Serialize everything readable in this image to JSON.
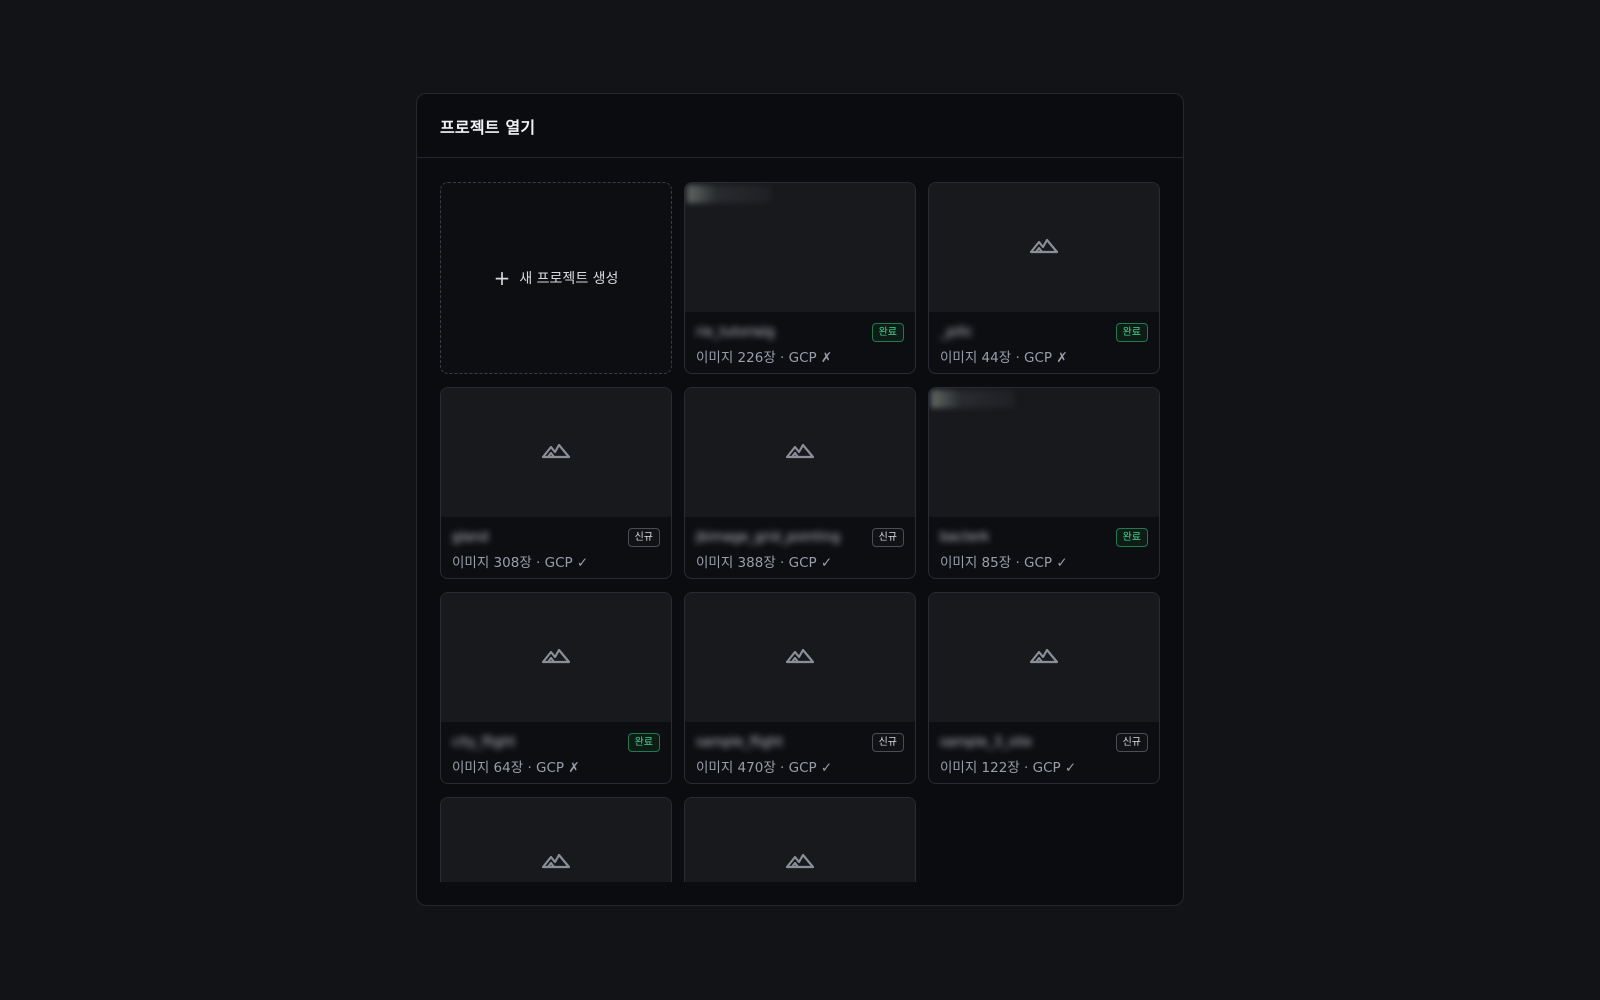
{
  "modal": {
    "title": "프로젝트 열기",
    "new_project_label": "새 프로젝트 생성"
  },
  "colors": {
    "background": "#121317",
    "panel": "#0b0c0f",
    "done_badge": "#46d592",
    "new_badge": "#d9dbe0"
  },
  "projects": [
    {
      "name": "rie_tutorialg",
      "badge": "완료",
      "status": "done",
      "meta": "이미지 226장 · GCP ✗",
      "thumb": "broken-image"
    },
    {
      "name": "_pillc",
      "badge": "완료",
      "status": "done",
      "meta": "이미지 44장 · GCP ✗",
      "thumb": "placeholder"
    },
    {
      "name": "gland",
      "badge": "신규",
      "status": "new",
      "meta": "이미지 308장 · GCP ✓",
      "thumb": "placeholder"
    },
    {
      "name": "jbimage_grid_pointing",
      "badge": "신규",
      "status": "new",
      "meta": "이미지 388장 · GCP ✓",
      "thumb": "placeholder"
    },
    {
      "name": "bacterk",
      "badge": "완료",
      "status": "done",
      "meta": "이미지 85장 · GCP ✓",
      "thumb": "broken-image"
    },
    {
      "name": "city_flight",
      "badge": "완료",
      "status": "done",
      "meta": "이미지 64장 · GCP ✗",
      "thumb": "placeholder"
    },
    {
      "name": "sample_flight",
      "badge": "신규",
      "status": "new",
      "meta": "이미지 470장 · GCP ✓",
      "thumb": "placeholder"
    },
    {
      "name": "sample_3_site",
      "badge": "신규",
      "status": "new",
      "meta": "이미지 122장 · GCP ✓",
      "thumb": "placeholder"
    },
    {
      "name": "",
      "badge": "",
      "status": "",
      "meta": "",
      "thumb": "placeholder"
    },
    {
      "name": "",
      "badge": "",
      "status": "",
      "meta": "",
      "thumb": "placeholder"
    }
  ]
}
